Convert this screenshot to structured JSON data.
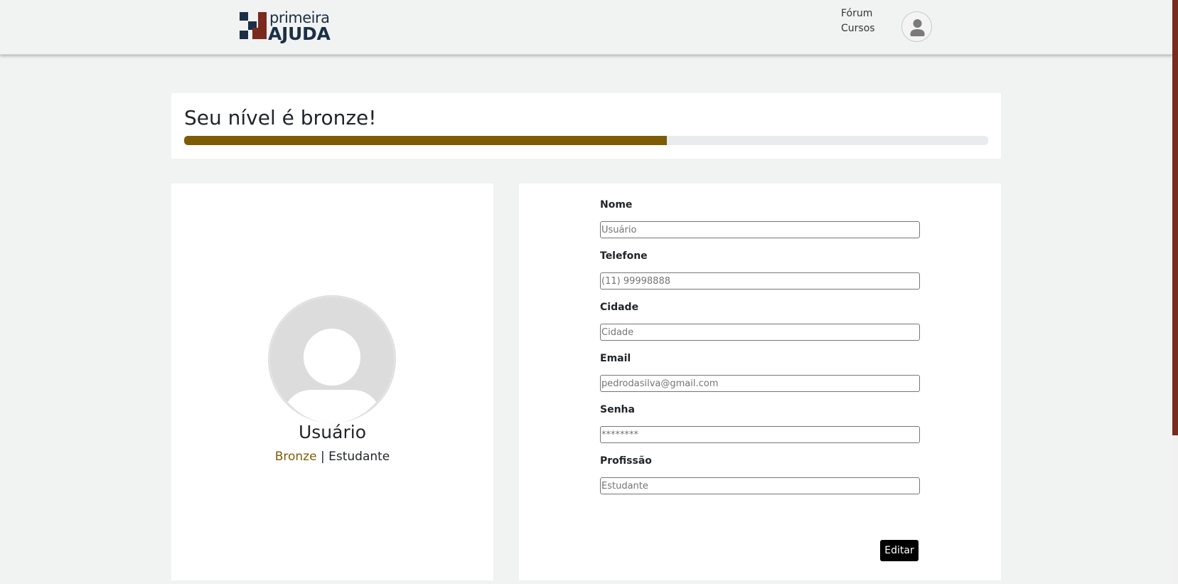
{
  "header": {
    "logo": {
      "text_top": "primeira",
      "text_bottom": "AJUDA"
    },
    "nav": [
      {
        "label": "Fórum"
      },
      {
        "label": "Cursos"
      }
    ],
    "avatar_icon": "user-icon"
  },
  "level": {
    "title": "Seu nível é bronze!",
    "progress_percent": 60,
    "bar_color": "#7c5c06"
  },
  "profile": {
    "name": "Usuário",
    "level_word": "Bronze",
    "separator": " | ",
    "role": "Estudante",
    "avatar_icon": "user-avatar-icon"
  },
  "form": {
    "fields": [
      {
        "label": "Nome",
        "placeholder": "Usuário"
      },
      {
        "label": "Telefone",
        "placeholder": "(11) 99998888"
      },
      {
        "label": "Cidade",
        "placeholder": "Cidade"
      },
      {
        "label": "Email",
        "placeholder": "pedrodasilva@gmail.com"
      },
      {
        "label": "Senha",
        "placeholder": "********"
      },
      {
        "label": "Profissão",
        "placeholder": "Estudante"
      }
    ],
    "submit_label": "Editar"
  },
  "colors": {
    "brand_dark": "#1c2f48",
    "brand_red": "#7b2a1f",
    "bronze": "#7c5c06",
    "background": "#f1f3f2"
  }
}
